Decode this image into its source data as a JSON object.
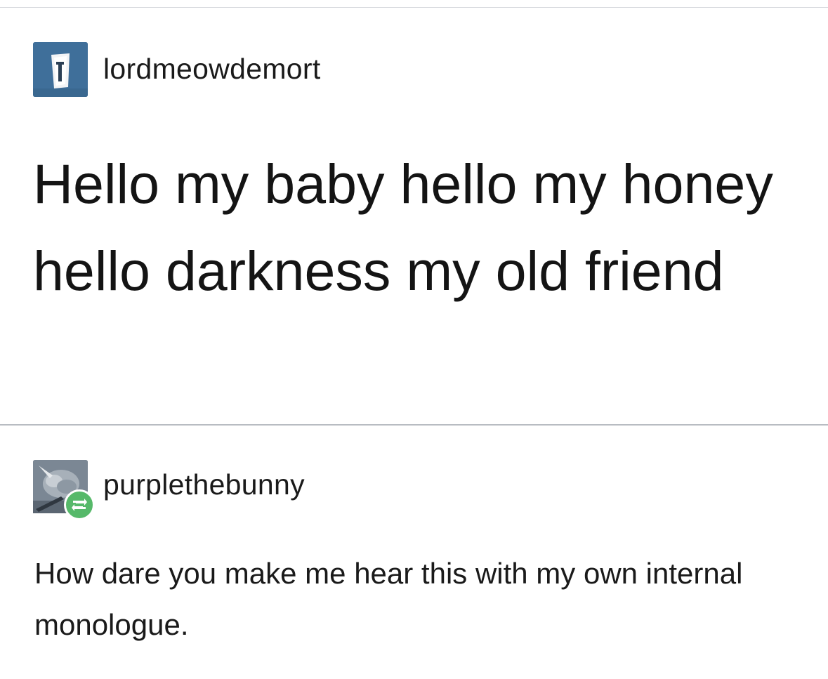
{
  "post": {
    "author": "lordmeowdemort",
    "body": "Hello my baby hello my honey hello darkness my old friend"
  },
  "reblog": {
    "author": "purplethebunny",
    "body": "How dare you make me hear this with my own internal monologue."
  },
  "icons": {
    "post_avatar": "avatar-icon",
    "reblog_avatar": "avatar-icon",
    "reblog_badge": "reblog-icon"
  },
  "colors": {
    "avatar_blue": "#3f6f9a",
    "reblog_green": "#56b96a",
    "divider": "#b8bcc2"
  }
}
